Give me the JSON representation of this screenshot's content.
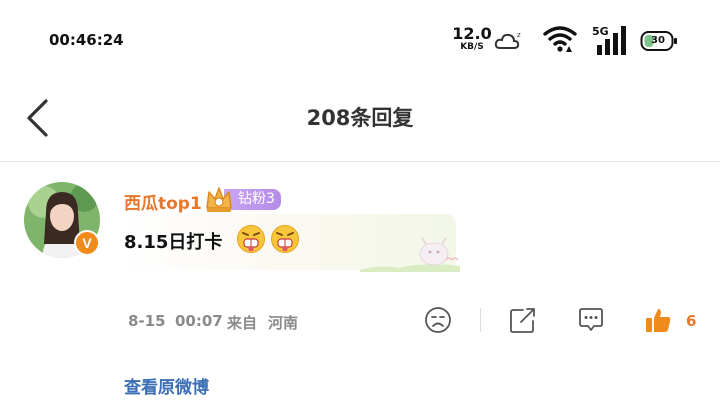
{
  "status_bar": {
    "time": "00:46:24",
    "net_speed_value": "12.0",
    "net_speed_unit": "KB/S",
    "signal_label": "5G",
    "battery_level": "30"
  },
  "header": {
    "title": "208条回复"
  },
  "comment": {
    "username": "西瓜top1",
    "fan_badge": "钻粉3",
    "verified_mark": "V",
    "text": "8.15日打卡",
    "date": "8-15",
    "time": "00:07",
    "from_label": "来自",
    "location": "河南",
    "like_count": "6"
  },
  "footer": {
    "view_original": "查看原微博"
  },
  "colors": {
    "accent_orange": "#e8772c",
    "link_blue": "#3b6fb6",
    "fan_badge_purple": "#b48be8",
    "meta_gray": "#8a8a8a"
  },
  "icons": [
    "back-arrow-icon",
    "cloud-moon-icon",
    "wifi-icon",
    "signal-icon",
    "battery-icon",
    "crown-icon",
    "grimace-emoji-icon",
    "sad-face-icon",
    "share-icon",
    "comment-icon",
    "thumbs-up-icon"
  ]
}
